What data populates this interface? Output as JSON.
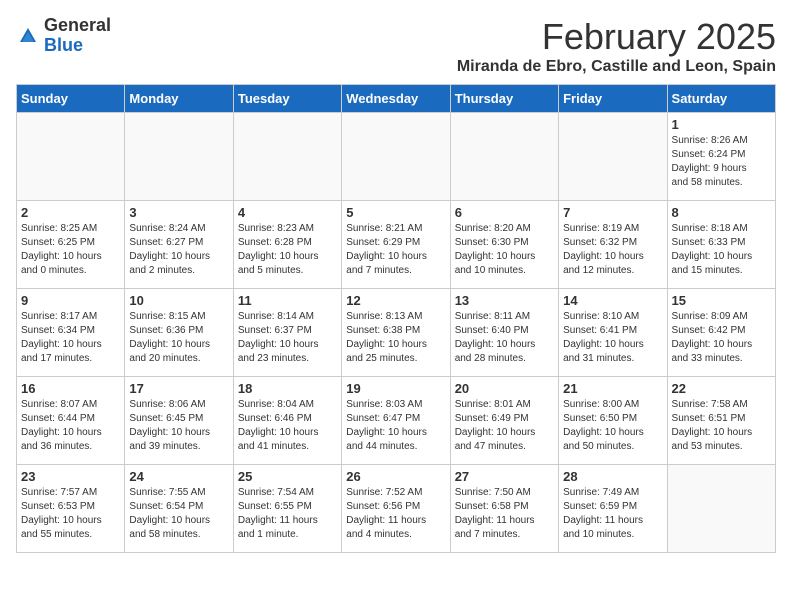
{
  "logo": {
    "general": "General",
    "blue": "Blue"
  },
  "title": "February 2025",
  "location": "Miranda de Ebro, Castille and Leon, Spain",
  "days_of_week": [
    "Sunday",
    "Monday",
    "Tuesday",
    "Wednesday",
    "Thursday",
    "Friday",
    "Saturday"
  ],
  "weeks": [
    [
      {
        "day": "",
        "info": ""
      },
      {
        "day": "",
        "info": ""
      },
      {
        "day": "",
        "info": ""
      },
      {
        "day": "",
        "info": ""
      },
      {
        "day": "",
        "info": ""
      },
      {
        "day": "",
        "info": ""
      },
      {
        "day": "1",
        "info": "Sunrise: 8:26 AM\nSunset: 6:24 PM\nDaylight: 9 hours\nand 58 minutes."
      }
    ],
    [
      {
        "day": "2",
        "info": "Sunrise: 8:25 AM\nSunset: 6:25 PM\nDaylight: 10 hours\nand 0 minutes."
      },
      {
        "day": "3",
        "info": "Sunrise: 8:24 AM\nSunset: 6:27 PM\nDaylight: 10 hours\nand 2 minutes."
      },
      {
        "day": "4",
        "info": "Sunrise: 8:23 AM\nSunset: 6:28 PM\nDaylight: 10 hours\nand 5 minutes."
      },
      {
        "day": "5",
        "info": "Sunrise: 8:21 AM\nSunset: 6:29 PM\nDaylight: 10 hours\nand 7 minutes."
      },
      {
        "day": "6",
        "info": "Sunrise: 8:20 AM\nSunset: 6:30 PM\nDaylight: 10 hours\nand 10 minutes."
      },
      {
        "day": "7",
        "info": "Sunrise: 8:19 AM\nSunset: 6:32 PM\nDaylight: 10 hours\nand 12 minutes."
      },
      {
        "day": "8",
        "info": "Sunrise: 8:18 AM\nSunset: 6:33 PM\nDaylight: 10 hours\nand 15 minutes."
      }
    ],
    [
      {
        "day": "9",
        "info": "Sunrise: 8:17 AM\nSunset: 6:34 PM\nDaylight: 10 hours\nand 17 minutes."
      },
      {
        "day": "10",
        "info": "Sunrise: 8:15 AM\nSunset: 6:36 PM\nDaylight: 10 hours\nand 20 minutes."
      },
      {
        "day": "11",
        "info": "Sunrise: 8:14 AM\nSunset: 6:37 PM\nDaylight: 10 hours\nand 23 minutes."
      },
      {
        "day": "12",
        "info": "Sunrise: 8:13 AM\nSunset: 6:38 PM\nDaylight: 10 hours\nand 25 minutes."
      },
      {
        "day": "13",
        "info": "Sunrise: 8:11 AM\nSunset: 6:40 PM\nDaylight: 10 hours\nand 28 minutes."
      },
      {
        "day": "14",
        "info": "Sunrise: 8:10 AM\nSunset: 6:41 PM\nDaylight: 10 hours\nand 31 minutes."
      },
      {
        "day": "15",
        "info": "Sunrise: 8:09 AM\nSunset: 6:42 PM\nDaylight: 10 hours\nand 33 minutes."
      }
    ],
    [
      {
        "day": "16",
        "info": "Sunrise: 8:07 AM\nSunset: 6:44 PM\nDaylight: 10 hours\nand 36 minutes."
      },
      {
        "day": "17",
        "info": "Sunrise: 8:06 AM\nSunset: 6:45 PM\nDaylight: 10 hours\nand 39 minutes."
      },
      {
        "day": "18",
        "info": "Sunrise: 8:04 AM\nSunset: 6:46 PM\nDaylight: 10 hours\nand 41 minutes."
      },
      {
        "day": "19",
        "info": "Sunrise: 8:03 AM\nSunset: 6:47 PM\nDaylight: 10 hours\nand 44 minutes."
      },
      {
        "day": "20",
        "info": "Sunrise: 8:01 AM\nSunset: 6:49 PM\nDaylight: 10 hours\nand 47 minutes."
      },
      {
        "day": "21",
        "info": "Sunrise: 8:00 AM\nSunset: 6:50 PM\nDaylight: 10 hours\nand 50 minutes."
      },
      {
        "day": "22",
        "info": "Sunrise: 7:58 AM\nSunset: 6:51 PM\nDaylight: 10 hours\nand 53 minutes."
      }
    ],
    [
      {
        "day": "23",
        "info": "Sunrise: 7:57 AM\nSunset: 6:53 PM\nDaylight: 10 hours\nand 55 minutes."
      },
      {
        "day": "24",
        "info": "Sunrise: 7:55 AM\nSunset: 6:54 PM\nDaylight: 10 hours\nand 58 minutes."
      },
      {
        "day": "25",
        "info": "Sunrise: 7:54 AM\nSunset: 6:55 PM\nDaylight: 11 hours\nand 1 minute."
      },
      {
        "day": "26",
        "info": "Sunrise: 7:52 AM\nSunset: 6:56 PM\nDaylight: 11 hours\nand 4 minutes."
      },
      {
        "day": "27",
        "info": "Sunrise: 7:50 AM\nSunset: 6:58 PM\nDaylight: 11 hours\nand 7 minutes."
      },
      {
        "day": "28",
        "info": "Sunrise: 7:49 AM\nSunset: 6:59 PM\nDaylight: 11 hours\nand 10 minutes."
      },
      {
        "day": "",
        "info": ""
      }
    ]
  ]
}
